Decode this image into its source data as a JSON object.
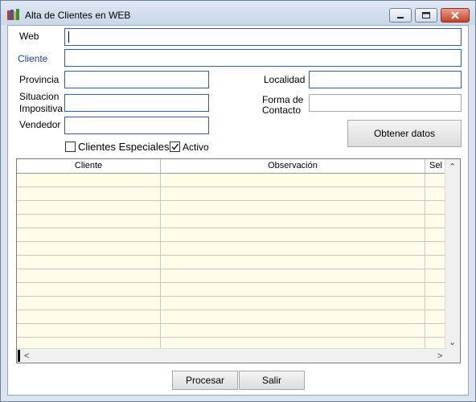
{
  "window": {
    "title": "Alta de Clientes en WEB"
  },
  "form": {
    "web_label": "Web",
    "cliente_label": "Cliente",
    "provincia_label": "Provincia",
    "localidad_label": "Localidad",
    "situacion_label_1": "Situacion",
    "situacion_label_2": "Impositiva",
    "forma_label_1": "Forma de",
    "forma_label_2": "Contacto",
    "vendedor_label": "Vendedor",
    "clientes_especiales_label": "Clientes Especiales",
    "activo_label": "Activo",
    "clientes_especiales_checked": false,
    "activo_checked": true,
    "obtener_label": "Obtener datos"
  },
  "grid": {
    "columns": [
      "Cliente",
      "Observación",
      "Sel"
    ],
    "row_count": 13
  },
  "footer": {
    "procesar_label": "Procesar",
    "salir_label": "Salir"
  },
  "colors": {
    "input_border": "#2b5ccf",
    "row_bg": "#fffde9",
    "label_blue": "#1f3fb0"
  }
}
